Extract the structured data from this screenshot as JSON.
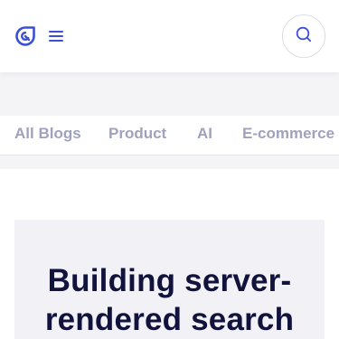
{
  "header": {
    "logo_icon": "algolia-logo-icon",
    "menu_icon": "hamburger-menu-icon",
    "search_icon": "search-icon",
    "accent_color": "#3b4fd8"
  },
  "categories": {
    "tabs": [
      {
        "label": "All Blogs"
      },
      {
        "label": "Product"
      },
      {
        "label": "AI"
      },
      {
        "label": "E-commerce"
      }
    ]
  },
  "article": {
    "title": "Building server-rendered search"
  }
}
